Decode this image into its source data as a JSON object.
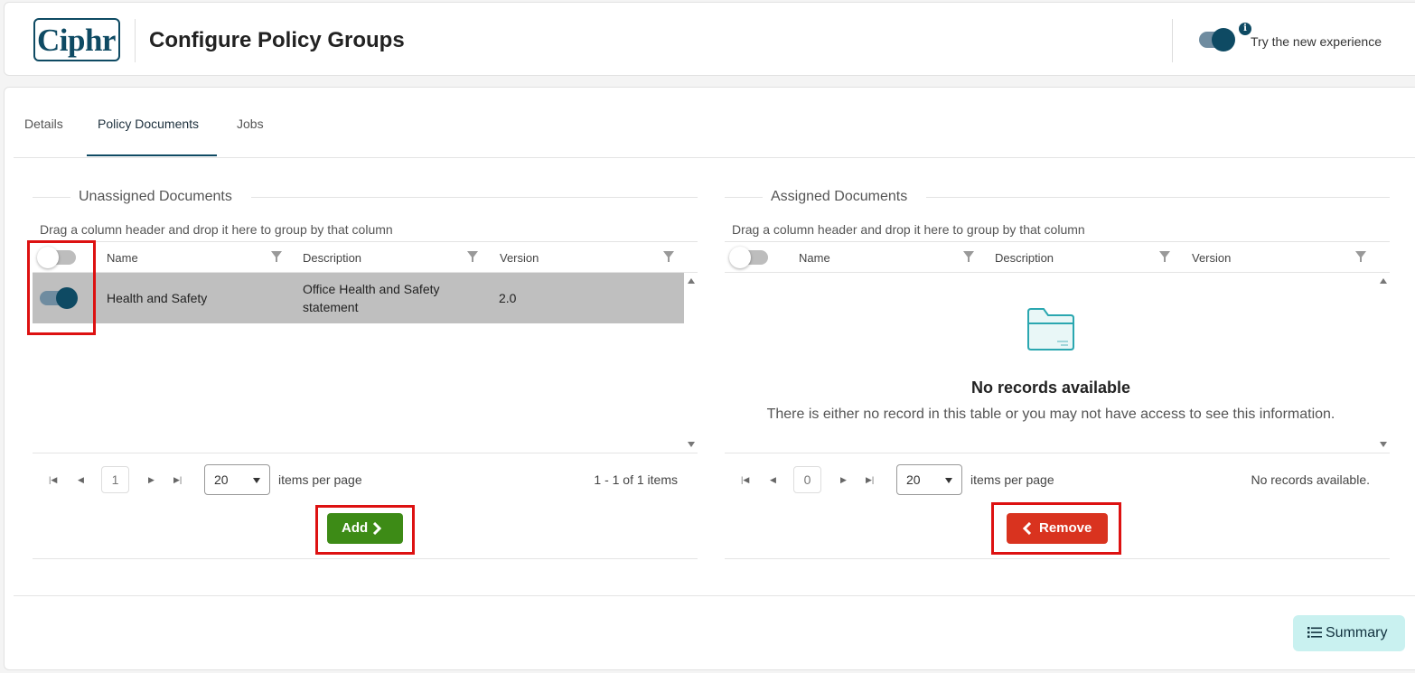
{
  "header": {
    "logo_text": "Ciphr",
    "title": "Configure Policy Groups",
    "new_experience_label": "Try the new experience",
    "info_icon": "i"
  },
  "tabs": [
    {
      "label": "Details",
      "active": false
    },
    {
      "label": "Policy Documents",
      "active": true
    },
    {
      "label": "Jobs",
      "active": false
    }
  ],
  "unassigned": {
    "title": "Unassigned Documents",
    "group_hint": "Drag a column header and drop it here to group by that column",
    "columns": [
      "Name",
      "Description",
      "Version"
    ],
    "rows": [
      {
        "name": "Health and Safety",
        "description_line1": "Office Health and Safety",
        "description_line2": "statement",
        "version": "2.0",
        "selected": true
      }
    ],
    "pager": {
      "page": "1",
      "page_size": "20",
      "per_page_label": "items per page",
      "info": "1 - 1 of 1 items"
    },
    "action_label": "Add"
  },
  "assigned": {
    "title": "Assigned Documents",
    "group_hint": "Drag a column header and drop it here to group by that column",
    "columns": [
      "Name",
      "Description",
      "Version"
    ],
    "empty_title": "No records available",
    "empty_text": "There is either no record in this table or you may not have access to see this information.",
    "pager": {
      "page": "0",
      "page_size": "20",
      "per_page_label": "items per page",
      "info": "No records available."
    },
    "action_label": "Remove"
  },
  "footer": {
    "summary_label": "Summary"
  },
  "colors": {
    "brand": "#0e4a63",
    "add_button": "#3d8b16",
    "remove_button": "#d9331f",
    "selected_row": "#bfbfbf",
    "summary_button": "#c9f1f0",
    "highlight": "#dd1111"
  }
}
